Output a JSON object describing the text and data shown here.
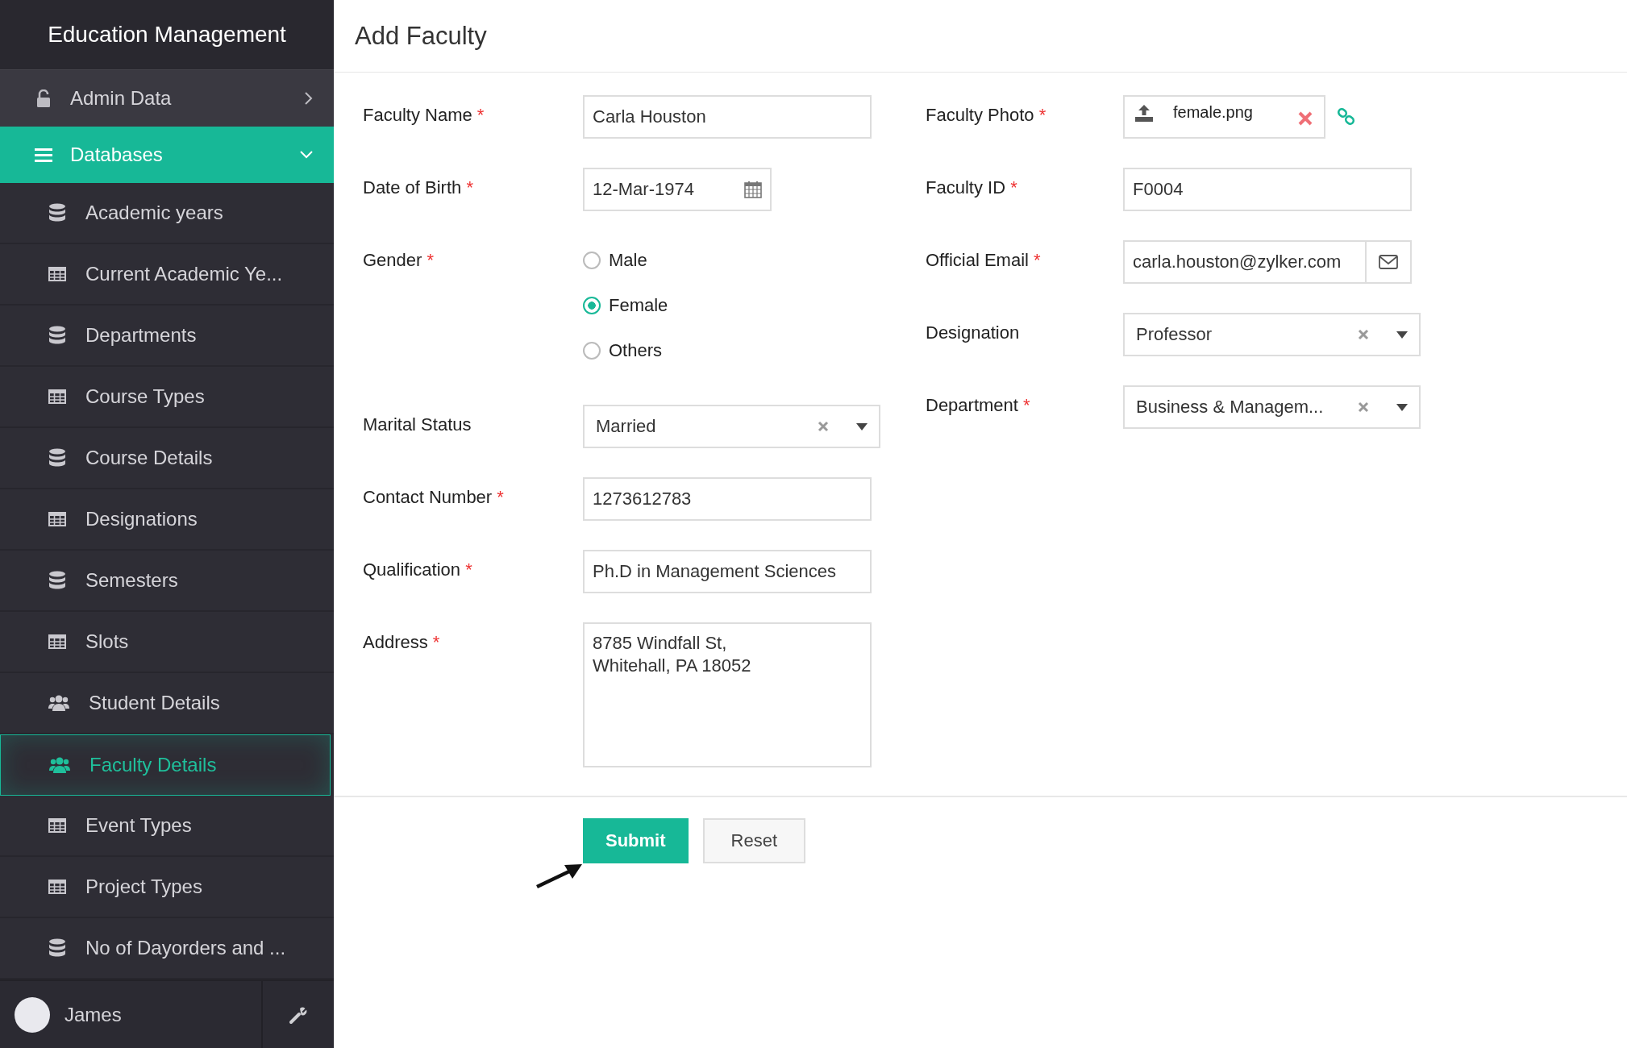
{
  "app_title": "Education Management",
  "sidebar": {
    "groups": [
      {
        "label": "Admin Data",
        "kind": "lock",
        "expanded": false,
        "selected": false
      },
      {
        "label": "Databases",
        "kind": "menu",
        "expanded": true,
        "selected": true
      }
    ],
    "items": [
      {
        "label": "Academic years",
        "kind": "database",
        "selected": false
      },
      {
        "label": "Current Academic Ye...",
        "kind": "table",
        "selected": false
      },
      {
        "label": "Departments",
        "kind": "database",
        "selected": false
      },
      {
        "label": "Course Types",
        "kind": "table",
        "selected": false
      },
      {
        "label": "Course Details",
        "kind": "database",
        "selected": false
      },
      {
        "label": "Designations",
        "kind": "table",
        "selected": false
      },
      {
        "label": "Semesters",
        "kind": "database",
        "selected": false
      },
      {
        "label": "Slots",
        "kind": "table",
        "selected": false
      },
      {
        "label": "Student Details",
        "kind": "users",
        "selected": false
      },
      {
        "label": "Faculty Details",
        "kind": "users",
        "selected": true
      },
      {
        "label": "Event Types",
        "kind": "table",
        "selected": false
      },
      {
        "label": "Project Types",
        "kind": "table",
        "selected": false
      },
      {
        "label": "No of Dayorders and ...",
        "kind": "database",
        "selected": false
      }
    ],
    "user": {
      "name": "James"
    }
  },
  "page": {
    "title": "Add Faculty"
  },
  "form": {
    "columns": [
      [
        {
          "kind": "text",
          "label": "Faculty Name",
          "required_mark": "*",
          "value": "Carla Houston"
        },
        {
          "kind": "date",
          "label": "Date of Birth",
          "required_mark": "*",
          "value": "12-Mar-1974"
        },
        {
          "kind": "radio",
          "label": "Gender",
          "required_mark": "*",
          "options": [
            {
              "label": "Male",
              "selected": false
            },
            {
              "label": "Female",
              "selected": true
            },
            {
              "label": "Others",
              "selected": false
            }
          ]
        },
        {
          "kind": "select",
          "label": "Marital Status",
          "value": "Married"
        },
        {
          "kind": "text",
          "label": "Contact Number",
          "required_mark": "*",
          "value": "1273612783"
        },
        {
          "kind": "text",
          "label": "Qualification",
          "required_mark": "*",
          "value": "Ph.D in Management Sciences"
        },
        {
          "kind": "textarea",
          "label": "Address",
          "required_mark": "*",
          "value": "8785 Windfall St,\nWhitehall, PA 18052"
        }
      ],
      [
        {
          "kind": "file",
          "label": "Faculty Photo",
          "required_mark": "*",
          "value": "female.png"
        },
        {
          "kind": "text",
          "label": "Faculty ID",
          "required_mark": "*",
          "value": "F0004"
        },
        {
          "kind": "email",
          "label": "Official Email",
          "required_mark": "*",
          "value": "carla.houston@zylker.com"
        },
        {
          "kind": "select",
          "label": "Designation",
          "value": "Professor"
        },
        {
          "kind": "select",
          "label": "Department",
          "required_mark": "*",
          "value": "Business & Managem..."
        }
      ]
    ]
  },
  "buttons": [
    {
      "label": "Submit",
      "kind": "primary"
    },
    {
      "label": "Reset",
      "kind": "secondary"
    }
  ]
}
